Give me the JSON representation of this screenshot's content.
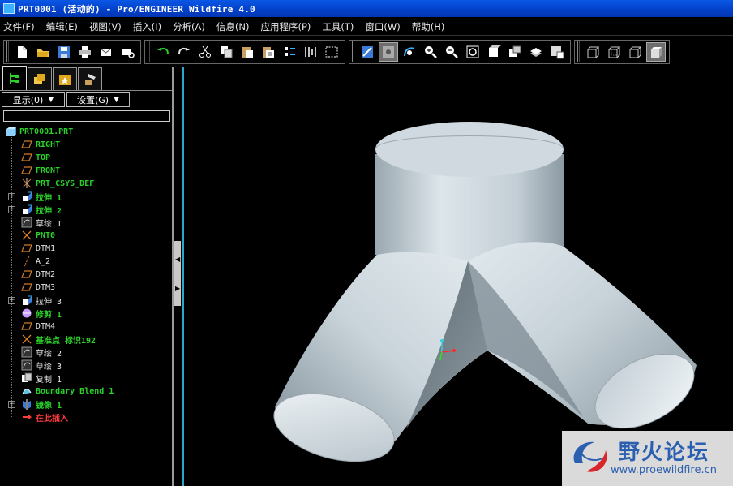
{
  "window": {
    "title": "PRT0001 (活动的) - Pro/ENGINEER Wildfire 4.0"
  },
  "menu": [
    {
      "id": "file",
      "label": "文件(F)"
    },
    {
      "id": "edit",
      "label": "编辑(E)"
    },
    {
      "id": "view",
      "label": "视图(V)"
    },
    {
      "id": "insert",
      "label": "插入(I)"
    },
    {
      "id": "analysis",
      "label": "分析(A)"
    },
    {
      "id": "info",
      "label": "信息(N)"
    },
    {
      "id": "applications",
      "label": "应用程序(P)"
    },
    {
      "id": "tools",
      "label": "工具(T)"
    },
    {
      "id": "window",
      "label": "窗口(W)"
    },
    {
      "id": "help",
      "label": "帮助(H)"
    }
  ],
  "toolbar_groups": [
    [
      "new-icon",
      "open-icon",
      "save-icon",
      "print-icon",
      "email-icon",
      "email-link-icon"
    ],
    [
      "undo-icon",
      "redo-icon",
      "cut-icon",
      "copy-icon",
      "paste-icon",
      "paste-special-icon",
      "regenerate-icon",
      "ribbon-icon",
      "selection-filter-icon"
    ],
    [
      "repaint-icon",
      "spin-center-icon",
      "orient-icon",
      "zoom-in-icon",
      "zoom-out-icon",
      "refit-icon",
      "reorient-icon",
      "saved-views-icon",
      "layers-icon",
      "view-manager-icon"
    ],
    [
      "wireframe-icon",
      "hidden-line-icon",
      "no-hidden-icon",
      "shading-icon"
    ]
  ],
  "panel": {
    "tabs": [
      "model-tree-tab-icon",
      "folder-browser-tab-icon",
      "favorites-tab-icon",
      "connections-tab-icon"
    ],
    "show_label": "显示(0)",
    "settings_label": "设置(G)",
    "filter_value": ""
  },
  "tree": [
    {
      "label": "PRT0001.PRT",
      "color": "green",
      "icon": "part-icon",
      "indent": 0,
      "expander": ""
    },
    {
      "label": "RIGHT",
      "color": "green",
      "icon": "datum-plane-icon",
      "indent": 1,
      "expander": ""
    },
    {
      "label": "TOP",
      "color": "green",
      "icon": "datum-plane-icon",
      "indent": 1,
      "expander": ""
    },
    {
      "label": "FRONT",
      "color": "green",
      "icon": "datum-plane-icon",
      "indent": 1,
      "expander": ""
    },
    {
      "label": "PRT_CSYS_DEF",
      "color": "green",
      "icon": "csys-icon",
      "indent": 1,
      "expander": ""
    },
    {
      "label": "拉伸 1",
      "color": "green",
      "icon": "extrude-icon",
      "indent": 1,
      "expander": "+"
    },
    {
      "label": "拉伸 2",
      "color": "green",
      "icon": "extrude-icon",
      "indent": 1,
      "expander": "+"
    },
    {
      "label": "草绘 1",
      "color": "white",
      "icon": "sketch-icon",
      "indent": 1,
      "expander": ""
    },
    {
      "label": "PNT0",
      "color": "green",
      "icon": "datum-point-icon",
      "indent": 1,
      "expander": ""
    },
    {
      "label": "DTM1",
      "color": "white",
      "icon": "datum-plane-icon",
      "indent": 1,
      "expander": ""
    },
    {
      "label": "A_2",
      "color": "white",
      "icon": "datum-axis-icon",
      "indent": 1,
      "expander": ""
    },
    {
      "label": "DTM2",
      "color": "white",
      "icon": "datum-plane-icon",
      "indent": 1,
      "expander": ""
    },
    {
      "label": "DTM3",
      "color": "white",
      "icon": "datum-plane-icon",
      "indent": 1,
      "expander": ""
    },
    {
      "label": "拉伸 3",
      "color": "white",
      "icon": "extrude-icon",
      "indent": 1,
      "expander": "+"
    },
    {
      "label": "修剪 1",
      "color": "green",
      "icon": "trim-icon",
      "indent": 1,
      "expander": ""
    },
    {
      "label": "DTM4",
      "color": "white",
      "icon": "datum-plane-icon",
      "indent": 1,
      "expander": ""
    },
    {
      "label": "基准点 标识192",
      "color": "green",
      "icon": "datum-point-icon",
      "indent": 1,
      "expander": ""
    },
    {
      "label": "草绘 2",
      "color": "white",
      "icon": "sketch-icon",
      "indent": 1,
      "expander": ""
    },
    {
      "label": "草绘 3",
      "color": "white",
      "icon": "sketch-icon",
      "indent": 1,
      "expander": ""
    },
    {
      "label": "复制 1",
      "color": "white",
      "icon": "copy-feature-icon",
      "indent": 1,
      "expander": ""
    },
    {
      "label": "Boundary Blend 1",
      "color": "green",
      "icon": "boundary-blend-icon",
      "indent": 1,
      "expander": ""
    },
    {
      "label": "镜像 1",
      "color": "green",
      "icon": "mirror-icon",
      "indent": 1,
      "expander": "+"
    },
    {
      "label": "在此插入",
      "color": "red",
      "icon": "insert-here-icon",
      "indent": 1,
      "expander": ""
    }
  ],
  "colors": {
    "model_light": "#d3dde3",
    "model_mid": "#a9b7c0",
    "model_dark": "#6f7d86",
    "tree_green": "#2bd02b",
    "tree_red": "#ff3b3b",
    "splitter_accent": "#2aa8c9"
  },
  "watermark": {
    "title": "野火论坛",
    "url": "www.proewildfire.cn"
  }
}
